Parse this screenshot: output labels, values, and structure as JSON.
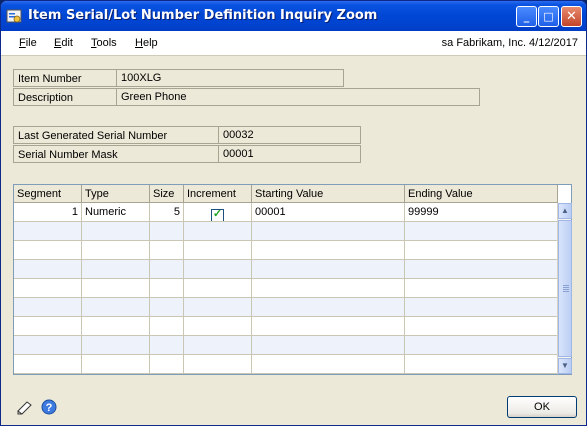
{
  "window": {
    "title": "Item Serial/Lot Number Definition Inquiry Zoom",
    "min_glyph": "_",
    "max_glyph": "□",
    "close_glyph": "✕"
  },
  "menu": {
    "items": [
      {
        "accel": "F",
        "rest": "ile"
      },
      {
        "accel": "E",
        "rest": "dit"
      },
      {
        "accel": "T",
        "rest": "ools"
      },
      {
        "accel": "H",
        "rest": "elp"
      }
    ],
    "user_info": "sa  Fabrikam, Inc.  4/12/2017"
  },
  "item": {
    "number_label": "Item Number",
    "number_value": "100XLG",
    "description_label": "Description",
    "description_value": "Green Phone"
  },
  "serial": {
    "last_generated_label": "Last Generated Serial Number",
    "last_generated_value": "00032",
    "mask_label": "Serial Number Mask",
    "mask_value": "00001"
  },
  "grid": {
    "columns": [
      "Segment",
      "Type",
      "Size",
      "Increment",
      "Starting Value",
      "Ending Value"
    ],
    "rows": [
      {
        "segment": "1",
        "type": "Numeric",
        "size": "5",
        "increment": true,
        "starting": "00001",
        "ending": "99999"
      }
    ]
  },
  "buttons": {
    "ok": "OK"
  },
  "colors": {
    "titlebar": "#0046d5",
    "window_bg": "#ece9d8",
    "grid_alt_row": "#eef3fb",
    "check": "#21a121"
  },
  "icons": [
    "app-icon",
    "note-icon",
    "help-icon",
    "scroll-up-icon",
    "scroll-down-icon",
    "checkmark-icon"
  ]
}
